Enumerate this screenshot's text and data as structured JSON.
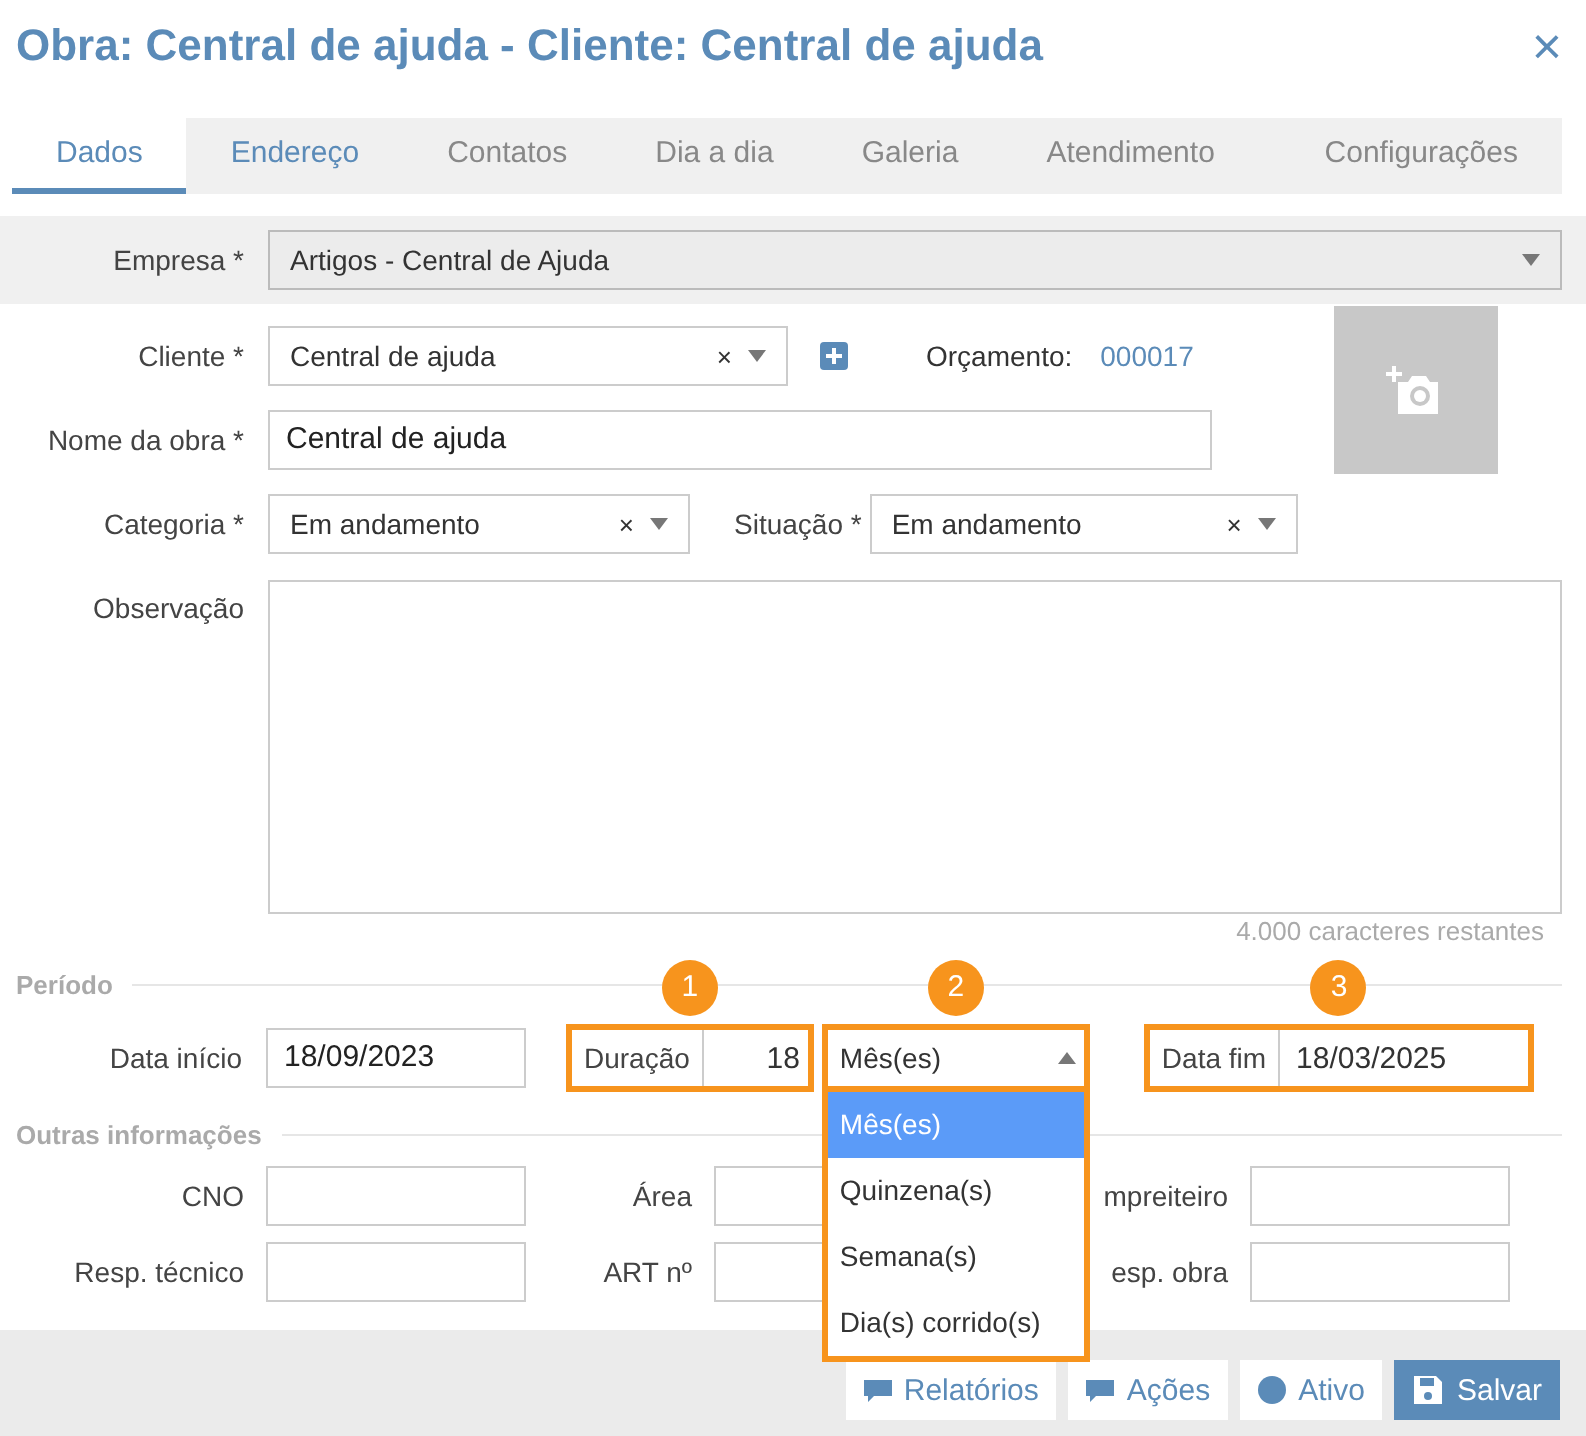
{
  "dialog": {
    "title": "Obra: Central de ajuda - Cliente: Central de ajuda",
    "close": "×"
  },
  "tabs": [
    {
      "label": "Dados",
      "selected": true,
      "hovered": false
    },
    {
      "label": "Endereço",
      "selected": false,
      "hovered": true
    },
    {
      "label": "Contatos",
      "selected": false,
      "hovered": false
    },
    {
      "label": "Dia a dia",
      "selected": false,
      "hovered": false
    },
    {
      "label": "Galeria",
      "selected": false,
      "hovered": false
    },
    {
      "label": "Atendimento",
      "selected": false,
      "hovered": false
    },
    {
      "label": "Configurações",
      "selected": false,
      "hovered": false
    }
  ],
  "empresa": {
    "label": "Empresa *",
    "value": "Artigos - Central de Ajuda"
  },
  "cliente": {
    "label": "Cliente *",
    "value": "Central de ajuda",
    "clear": "×"
  },
  "orcamento": {
    "label": "Orçamento:",
    "value": "000017"
  },
  "nome_da_obra": {
    "label": "Nome da obra *",
    "value": "Central de ajuda"
  },
  "categoria": {
    "label": "Categoria *",
    "value": "Em andamento",
    "clear": "×"
  },
  "situacao": {
    "label": "Situação *",
    "value": "Em andamento",
    "clear": "×"
  },
  "observacao": {
    "label": "Observação",
    "counter": "4.000  caracteres restantes"
  },
  "periodo": {
    "heading": "Período",
    "data_inicio": {
      "label": "Data início",
      "value": "18/09/2023"
    },
    "duracao": {
      "label": "Duração",
      "value": "18",
      "callout": "1"
    },
    "unidade": {
      "value": "Mês(es)",
      "callout": "2",
      "expanded": true,
      "options": [
        {
          "label": "Mês(es)",
          "selected": true
        },
        {
          "label": "Quinzena(s)",
          "selected": false
        },
        {
          "label": "Semana(s)",
          "selected": false
        },
        {
          "label": "Dia(s) corrido(s)",
          "selected": false
        }
      ]
    },
    "data_fim": {
      "label": "Data fim",
      "value": "18/03/2025",
      "callout": "3"
    }
  },
  "outras": {
    "heading": "Outras informações",
    "fields": [
      {
        "label": "CNO"
      },
      {
        "label": "Área"
      },
      {
        "label": "mpreiteiro"
      },
      {
        "label": "Resp. técnico"
      },
      {
        "label": "ART nº"
      },
      {
        "label": "esp. obra"
      }
    ]
  },
  "footer": {
    "buttons": [
      {
        "label": "Relatórios",
        "kind": "default"
      },
      {
        "label": "Ações",
        "kind": "default"
      },
      {
        "label": "Ativo",
        "kind": "toggle"
      },
      {
        "label": "Salvar",
        "kind": "primary"
      }
    ]
  }
}
